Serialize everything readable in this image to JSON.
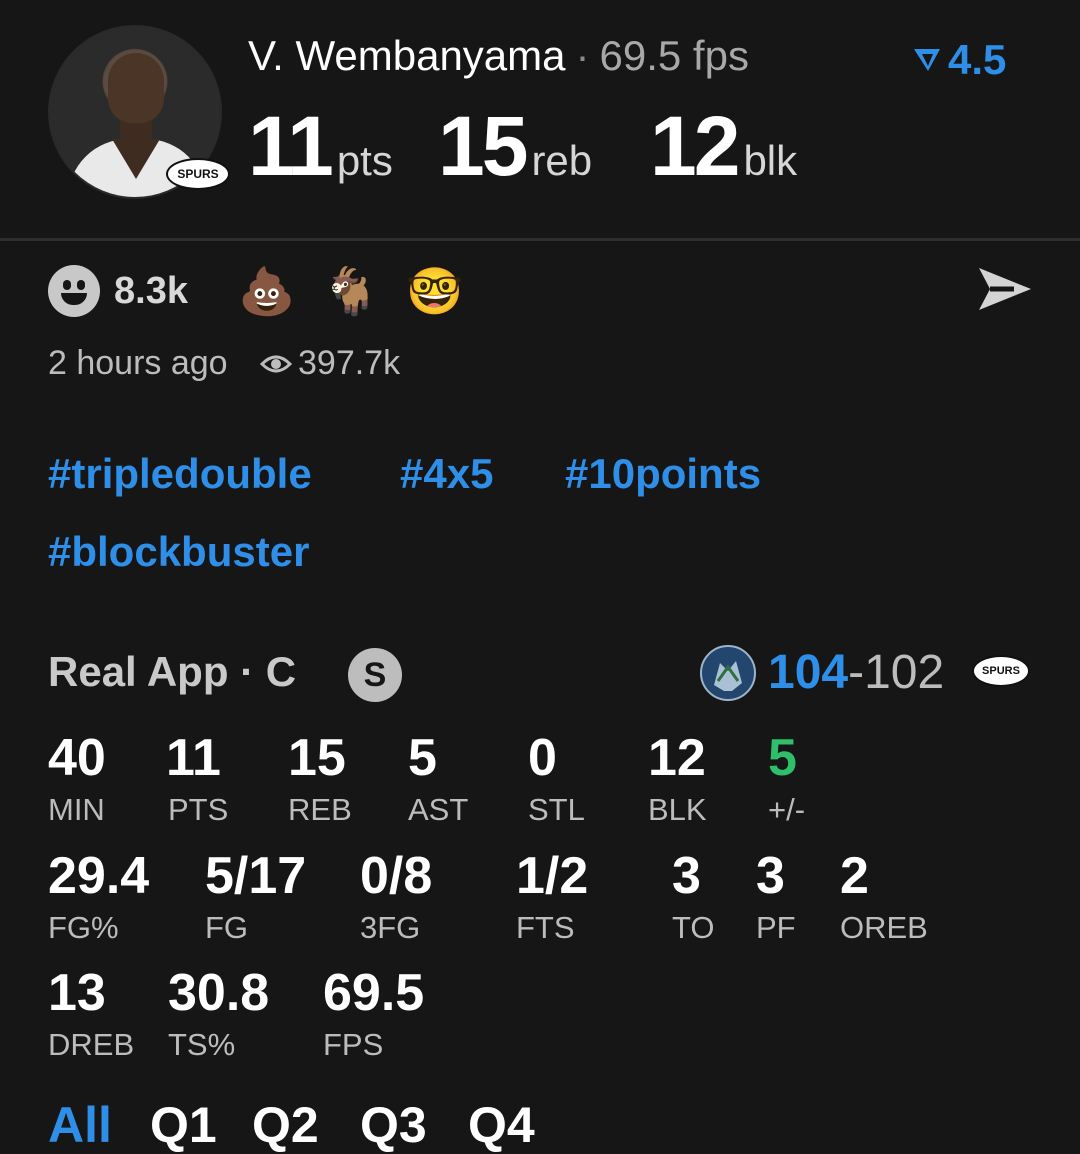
{
  "header": {
    "player_name": "V. Wembanyama",
    "separator": "·",
    "fps_label": "69.5 fps",
    "line_value": "4.5",
    "team_abbr": "SPURS",
    "stats": [
      {
        "value": "11",
        "unit": "pts"
      },
      {
        "value": "15",
        "unit": "reb"
      },
      {
        "value": "12",
        "unit": "blk"
      }
    ]
  },
  "reactions": {
    "count": "8.3k",
    "emojis": [
      "💩",
      "🐐",
      "🤓"
    ],
    "time_ago": "2 hours ago",
    "views": "397.7k"
  },
  "hashtags": [
    "#tripledouble",
    "#4x5",
    "#10points",
    "#blockbuster"
  ],
  "game": {
    "app_label": "Real App · C",
    "position_badge": "S",
    "away_score": "104",
    "dash": "-",
    "home_score": "102",
    "home_abbr": "SPURS"
  },
  "box_score": {
    "row1": [
      {
        "value": "40",
        "label": "MIN"
      },
      {
        "value": "11",
        "label": "PTS"
      },
      {
        "value": "15",
        "label": "REB"
      },
      {
        "value": "5",
        "label": "AST"
      },
      {
        "value": "0",
        "label": "STL"
      },
      {
        "value": "12",
        "label": "BLK"
      },
      {
        "value": "5",
        "label": "+/-"
      }
    ],
    "row2": [
      {
        "value": "29.4",
        "label": "FG%"
      },
      {
        "value": "5/17",
        "label": "FG"
      },
      {
        "value": "0/8",
        "label": "3FG"
      },
      {
        "value": "1/2",
        "label": "FTS"
      },
      {
        "value": "3",
        "label": "TO"
      },
      {
        "value": "3",
        "label": "PF"
      },
      {
        "value": "2",
        "label": "OREB"
      }
    ],
    "row3": [
      {
        "value": "13",
        "label": "DREB"
      },
      {
        "value": "30.8",
        "label": "TS%"
      },
      {
        "value": "69.5",
        "label": "FPS"
      }
    ]
  },
  "quarter_tabs": [
    "All",
    "Q1",
    "Q2",
    "Q3",
    "Q4"
  ],
  "colors": {
    "accent": "#2f8fe8",
    "positive": "#2fbf6a",
    "background": "#161616"
  }
}
